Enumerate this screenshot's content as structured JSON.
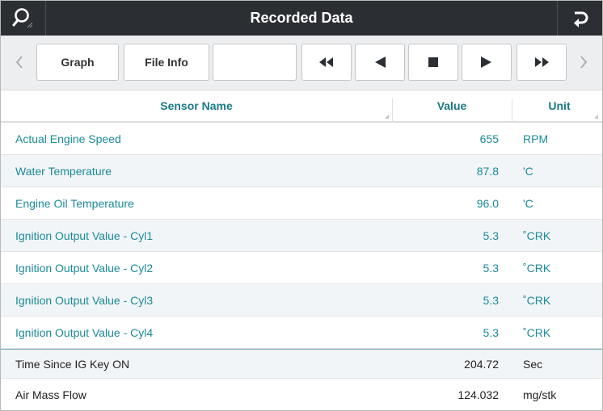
{
  "header": {
    "title": "Recorded Data",
    "search_icon": "search-icon",
    "back_icon": "return-arrow-icon"
  },
  "toolbar": {
    "graph_label": "Graph",
    "file_info_label": "File Info",
    "blank_label": "",
    "buttons": [
      "rewind",
      "prev",
      "stop",
      "play",
      "fast-forward"
    ]
  },
  "table": {
    "columns": [
      "Sensor Name",
      "Value",
      "Unit"
    ],
    "rows": [
      {
        "name": "Actual Engine Speed",
        "value": "655",
        "unit": "RPM"
      },
      {
        "name": "Water Temperature",
        "value": "87.8",
        "unit": "'C"
      },
      {
        "name": "Engine Oil Temperature",
        "value": "96.0",
        "unit": "'C"
      },
      {
        "name": "Ignition Output Value - Cyl1",
        "value": "5.3",
        "unit": "˚CRK"
      },
      {
        "name": "Ignition Output Value - Cyl2",
        "value": "5.3",
        "unit": "˚CRK"
      },
      {
        "name": "Ignition Output Value - Cyl3",
        "value": "5.3",
        "unit": "˚CRK"
      },
      {
        "name": "Ignition Output Value - Cyl4",
        "value": "5.3",
        "unit": "˚CRK"
      },
      {
        "name": "Time Since IG Key ON",
        "value": "204.72",
        "unit": "Sec"
      },
      {
        "name": "Air Mass Flow",
        "value": "124.032",
        "unit": "mg/stk"
      }
    ]
  },
  "colors": {
    "titlebar": "#2b2f33",
    "accent": "#1a8a9a",
    "header_text": "#1a7a85"
  }
}
